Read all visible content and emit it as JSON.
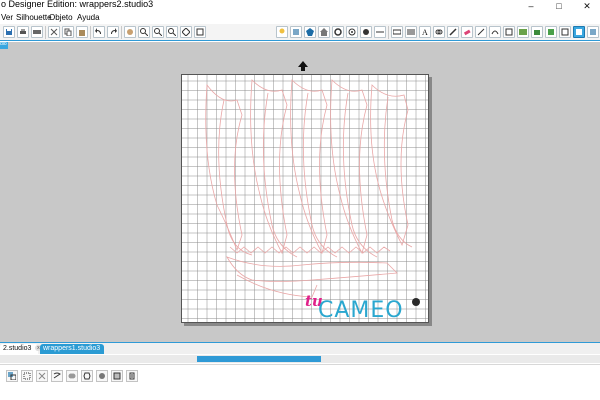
{
  "window": {
    "title": "o Designer Edition: wrappers2.studio3",
    "minimize_glyph": "–",
    "maximize_glyph": "□",
    "close_glyph": "✕"
  },
  "menu": {
    "items": [
      "Ver",
      "Silhouette",
      "Objeto",
      "Ayuda"
    ]
  },
  "toolbar": {
    "left_icons": [
      "save-icon",
      "print-icon",
      "send-to-cutter-icon",
      "cut-icon",
      "copy-icon",
      "paste-icon",
      "undo-icon",
      "redo-icon",
      "pan-icon",
      "zoom-in-icon",
      "zoom-out-icon",
      "zoom-selection-icon",
      "zoom-fit-icon",
      "fit-page-icon"
    ],
    "right_icons": [
      "bulb-icon",
      "shapes-icon",
      "polygon-icon",
      "house-icon",
      "gear-shape-icon",
      "target-icon",
      "fill-icon",
      "line-style-icon",
      "text-icon",
      "replicate-icon",
      "knife-icon",
      "eraser-icon",
      "pen-icon",
      "image-icon",
      "layers-icon",
      "page-setup-icon",
      "design-view-icon"
    ]
  },
  "workspace": {
    "side_tab_label": "dio"
  },
  "logo": {
    "tu": "tu",
    "cameo": "CAMEO"
  },
  "tabs": [
    {
      "label": "2.studio3",
      "active": true
    },
    {
      "label": "wrappers1.studio3",
      "active": false
    }
  ],
  "scroll": {
    "position": 0.33
  },
  "bottom_toolbar": {
    "icons": [
      "group-icon",
      "ungroup-icon",
      "compound-icon",
      "release-compound-icon",
      "weld-icon",
      "offset-icon",
      "trace-icon",
      "fill-pattern-icon"
    ]
  },
  "colors": {
    "accent": "#2f9ad6",
    "grid": "#8c8c8c",
    "cut_lines": "#e9a7a7",
    "logo_pink": "#e0218a",
    "logo_blue": "#2aa7cf"
  }
}
